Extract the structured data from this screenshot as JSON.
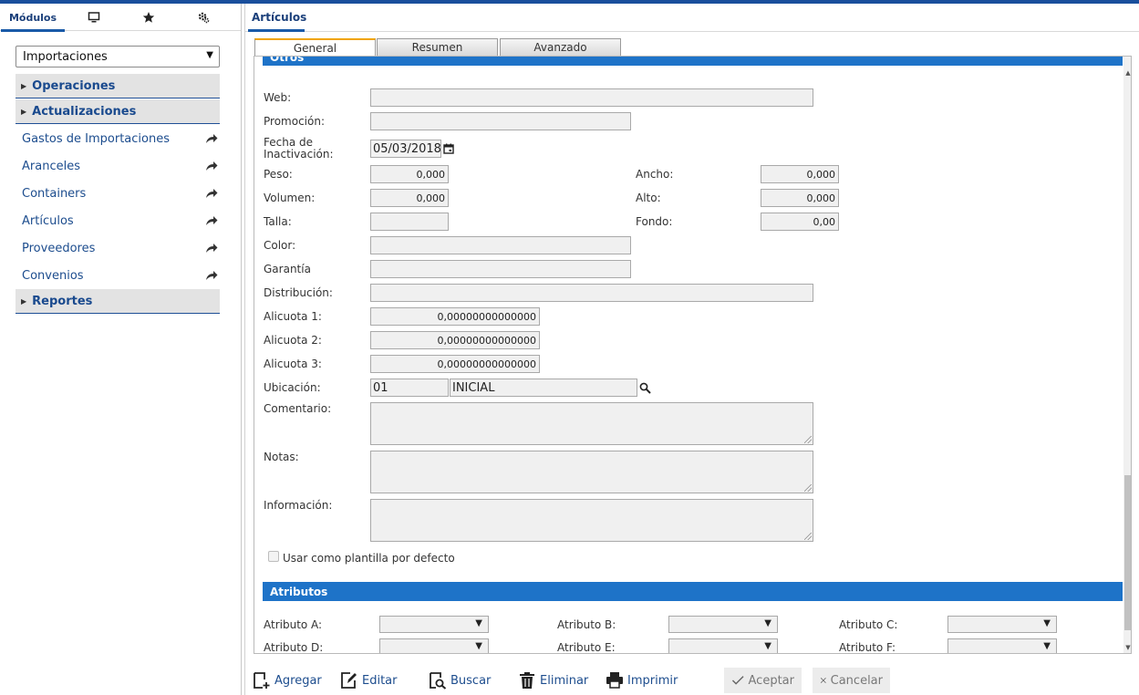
{
  "left": {
    "tabs": {
      "modulos": "Módulos"
    },
    "module_select": "Importaciones",
    "sections": {
      "operaciones": "Operaciones",
      "actualizaciones": "Actualizaciones",
      "reportes": "Reportes"
    },
    "items": [
      "Gastos de Importaciones",
      "Aranceles",
      "Containers",
      "Artículos",
      "Proveedores",
      "Convenios"
    ]
  },
  "right": {
    "title": "Artículos",
    "tabs": [
      "General",
      "Resumen",
      "Avanzado"
    ],
    "active_tab": "General"
  },
  "form": {
    "section_otros": "Otros",
    "labels": {
      "web": "Web:",
      "promocion": "Promoción:",
      "fecha_inact_1": "Fecha de",
      "fecha_inact_2": "Inactivación:",
      "peso": "Peso:",
      "ancho": "Ancho:",
      "volumen": "Volumen:",
      "alto": "Alto:",
      "talla": "Talla:",
      "fondo": "Fondo:",
      "color": "Color:",
      "garantia": "Garantía",
      "distribucion": "Distribución:",
      "alicuota1": "Alicuota 1:",
      "alicuota2": "Alicuota 2:",
      "alicuota3": "Alicuota 3:",
      "ubicacion": "Ubicación:",
      "comentario": "Comentario:",
      "notas": "Notas:",
      "informacion": "Información:"
    },
    "values": {
      "web": "",
      "promocion": "",
      "fecha_inactivacion": "05/03/2018",
      "peso": "0,000",
      "ancho": "0,000",
      "volumen": "0,000",
      "alto": "0,000",
      "talla": "",
      "fondo": "0,00",
      "color": "",
      "garantia": "",
      "distribucion": "",
      "alicuota1": "0,00000000000000",
      "alicuota2": "0,00000000000000",
      "alicuota3": "0,00000000000000",
      "ubicacion_codigo": "01",
      "ubicacion_nombre": "INICIAL"
    },
    "plantilla_checkbox_label": "Usar como plantilla por defecto",
    "plantilla_checked": false,
    "section_atributos": "Atributos",
    "atributos": {
      "a": "Atributo A:",
      "b": "Atributo B:",
      "c": "Atributo C:",
      "d": "Atributo D:",
      "e": "Atributo E:",
      "f": "Atributo F:"
    }
  },
  "toolbar": {
    "agregar": "Agregar",
    "editar": "Editar",
    "buscar": "Buscar",
    "eliminar": "Eliminar",
    "imprimir": "Imprimir",
    "aceptar": "Aceptar",
    "cancelar": "Cancelar"
  },
  "colors": {
    "accent": "#1e73c8",
    "nav_text": "#1d4d8e",
    "active_tab_top": "#f0a400"
  }
}
